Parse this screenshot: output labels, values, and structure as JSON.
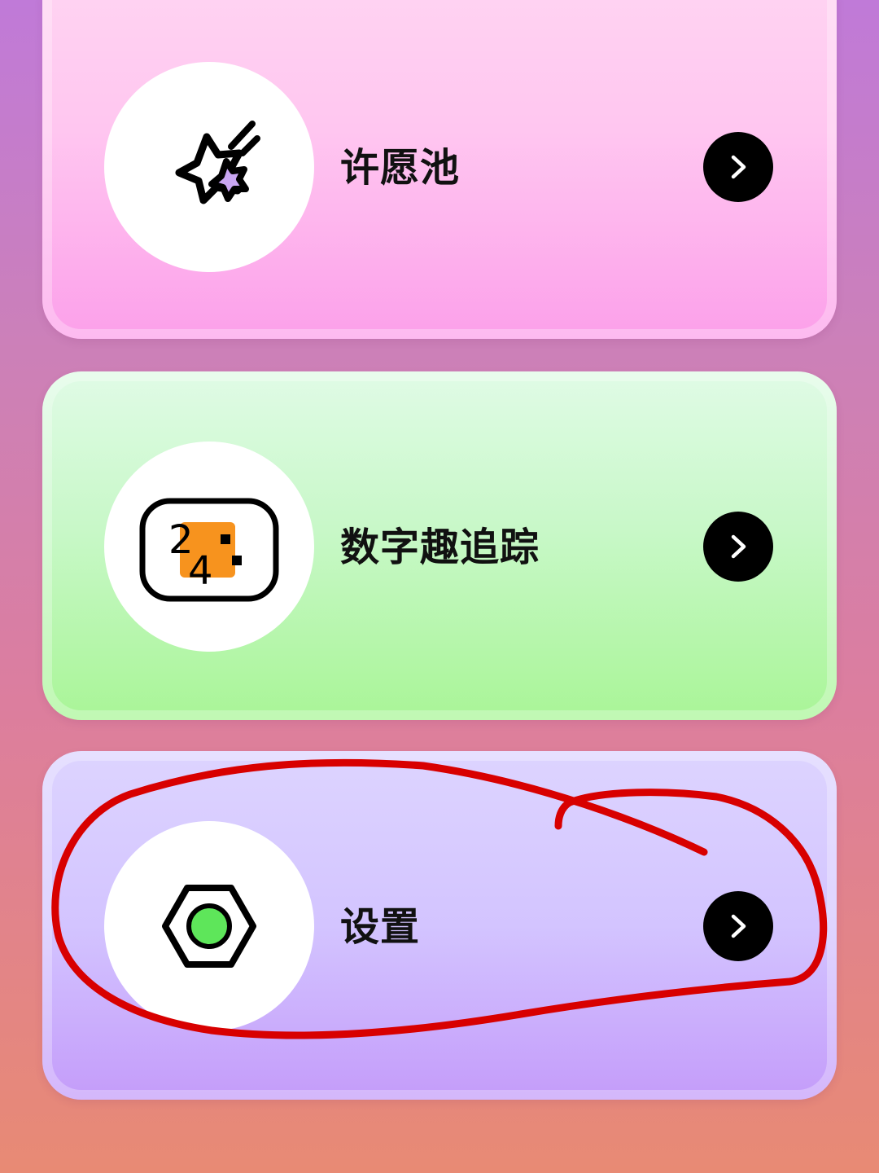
{
  "menu": {
    "items": [
      {
        "label": "许愿池",
        "icon": "shooting-star-icon"
      },
      {
        "label": "数字趣追踪",
        "icon": "number-tracker-icon",
        "icon_digits": [
          "2",
          "4"
        ]
      },
      {
        "label": "设置",
        "icon": "hex-nut-settings-icon"
      }
    ]
  },
  "colors": {
    "wish_card": "#fcb0ee",
    "number_card": "#b8f7ad",
    "settings_card": "#cdb4ff",
    "arrow_button": "#000000",
    "annotation_stroke": "#d80000",
    "icon_orange": "#f7931e",
    "icon_green": "#5ee65a",
    "icon_purple": "#c9a6f2"
  },
  "annotation": {
    "type": "hand-drawn-circle",
    "target": "设置"
  }
}
